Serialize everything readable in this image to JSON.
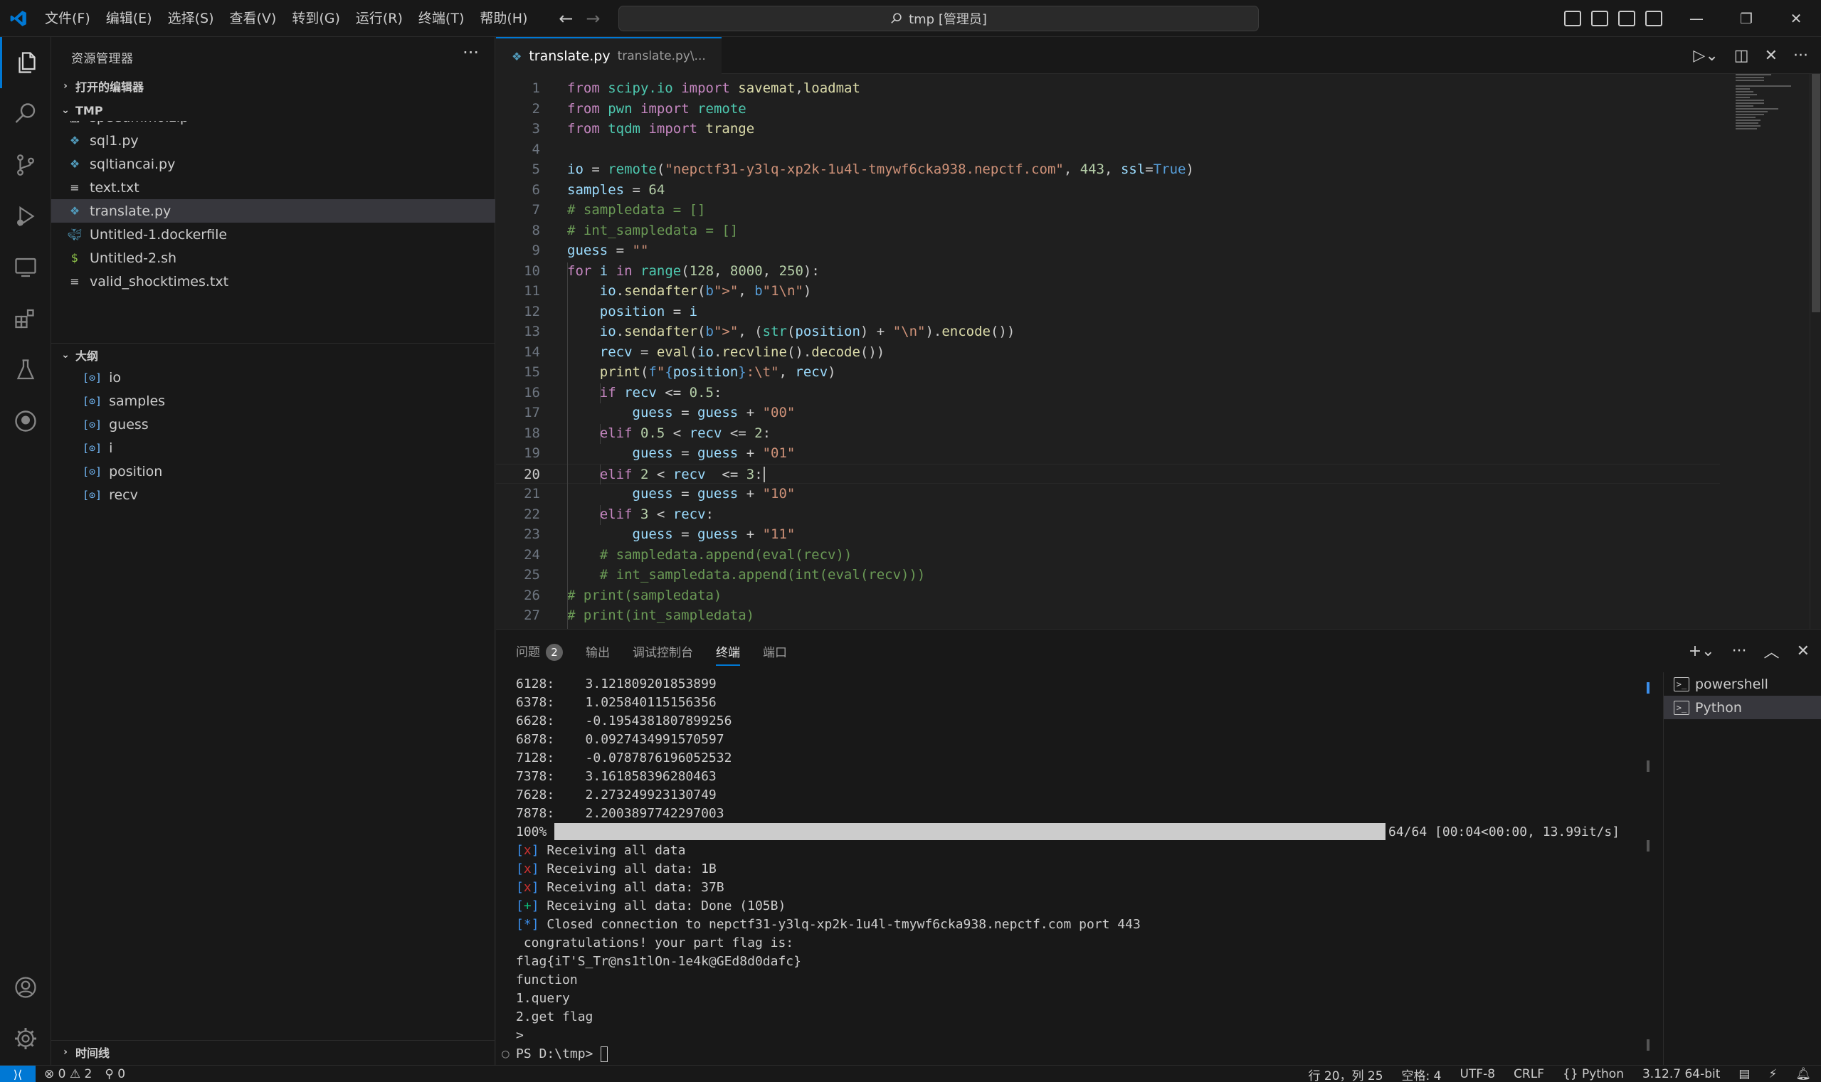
{
  "titlebar": {
    "menus": [
      "文件(F)",
      "编辑(E)",
      "选择(S)",
      "查看(V)",
      "转到(G)",
      "运行(R)",
      "终端(T)",
      "帮助(H)"
    ],
    "search_text": "tmp [管理员]",
    "accent": "#0078d4"
  },
  "sidebar": {
    "title": "资源管理器",
    "open_editors": "打开的编辑器",
    "folder": "TMP",
    "files": [
      {
        "name": "speedmmo.zip",
        "icon": "zip-icon",
        "color": "#cccccc"
      },
      {
        "name": "sql1.py",
        "icon": "python-icon",
        "color": "#519aba"
      },
      {
        "name": "sqltiancai.py",
        "icon": "python-icon",
        "color": "#519aba"
      },
      {
        "name": "text.txt",
        "icon": "text-file-icon",
        "color": "#cccccc"
      },
      {
        "name": "translate.py",
        "icon": "python-icon",
        "color": "#519aba"
      },
      {
        "name": "Untitled-1.dockerfile",
        "icon": "docker-icon",
        "color": "#519aba"
      },
      {
        "name": "Untitled-2.sh",
        "icon": "shell-icon",
        "color": "#8dc149"
      },
      {
        "name": "valid_shocktimes.txt",
        "icon": "text-file-icon",
        "color": "#cccccc"
      }
    ],
    "outline_title": "大纲",
    "outline": [
      "io",
      "samples",
      "guess",
      "i",
      "position",
      "recv"
    ],
    "timeline": "时间线"
  },
  "editor": {
    "tab_name": "translate.py",
    "tab_path": "translate.py\\...",
    "current_line": 20,
    "lines": [
      {
        "n": "1",
        "html": "<span class='kw'>from</span> <span class='mod'>scipy.io</span> <span class='kw'>import</span> <span class='fn'>savemat</span>,<span class='fn'>loadmat</span>"
      },
      {
        "n": "2",
        "html": "<span class='kw'>from</span> <span class='mod'>pwn</span> <span class='kw'>import</span> <span class='mod'>remote</span>"
      },
      {
        "n": "3",
        "html": "<span class='kw'>from</span> <span class='mod'>tqdm</span> <span class='kw'>import</span> <span class='fn'>trange</span>"
      },
      {
        "n": "4",
        "html": ""
      },
      {
        "n": "5",
        "html": "<span class='var'>io</span> = <span class='mod'>remote</span>(<span class='str'>\"nepctf31-y3lq-xp2k-1u4l-tmywf6cka938.nepctf.com\"</span>, <span class='num'>443</span>, <span class='var'>ssl</span>=<span class='bkw'>True</span>)"
      },
      {
        "n": "6",
        "html": "<span class='var'>samples</span> = <span class='num'>64</span>"
      },
      {
        "n": "7",
        "html": "<span class='cm'># sampledata = []</span>"
      },
      {
        "n": "8",
        "html": "<span class='cm'># int_sampledata = []</span>"
      },
      {
        "n": "9",
        "html": "<span class='var'>guess</span> = <span class='str'>\"\"</span>"
      },
      {
        "n": "10",
        "html": "<span class='kw'>for</span> <span class='var'>i</span> <span class='kw'>in</span> <span class='mod'>range</span>(<span class='num'>128</span>, <span class='num'>8000</span>, <span class='num'>250</span>):"
      },
      {
        "n": "11",
        "html": "    <span class='var'>io</span>.<span class='fn'>sendafter</span>(<span class='bkw'>b</span><span class='str'>\"&gt;\"</span>, <span class='bkw'>b</span><span class='str'>\"1\\n\"</span>)"
      },
      {
        "n": "12",
        "html": "    <span class='var'>position</span> = <span class='var'>i</span>"
      },
      {
        "n": "13",
        "html": "    <span class='var'>io</span>.<span class='fn'>sendafter</span>(<span class='bkw'>b</span><span class='str'>\"&gt;\"</span>, (<span class='mod'>str</span>(<span class='var'>position</span>) + <span class='str'>\"\\n\"</span>).<span class='fn'>encode</span>())"
      },
      {
        "n": "14",
        "html": "    <span class='var'>recv</span> = <span class='fn'>eval</span>(<span class='var'>io</span>.<span class='fn'>recvline</span>().<span class='fn'>decode</span>())"
      },
      {
        "n": "15",
        "html": "    <span class='fn'>print</span>(<span class='bkw'>f</span><span class='str'>\"</span><span class='bkw'>{</span><span class='var'>position</span><span class='bkw'>}</span><span class='str'>:\\t\"</span>, <span class='var'>recv</span>)"
      },
      {
        "n": "16",
        "html": "    <span class='kw'>if</span> <span class='var'>recv</span> &lt;= <span class='num'>0.5</span>:"
      },
      {
        "n": "17",
        "html": "        <span class='var'>guess</span> = <span class='var'>guess</span> + <span class='str'>\"00\"</span>"
      },
      {
        "n": "18",
        "html": "    <span class='kw'>elif</span> <span class='num'>0.5</span> &lt; <span class='var'>recv</span> &lt;= <span class='num'>2</span>:"
      },
      {
        "n": "19",
        "html": "        <span class='var'>guess</span> = <span class='var'>guess</span> + <span class='str'>\"01\"</span>"
      },
      {
        "n": "20",
        "html": "    <span class='kw'>elif</span> <span class='num'>2</span> &lt; <span class='var'>recv</span>  &lt;= <span class='num'>3</span>:"
      },
      {
        "n": "21",
        "html": "        <span class='var'>guess</span> = <span class='var'>guess</span> + <span class='str'>\"10\"</span>"
      },
      {
        "n": "22",
        "html": "    <span class='kw'>elif</span> <span class='num'>3</span> &lt; <span class='var'>recv</span>:"
      },
      {
        "n": "23",
        "html": "        <span class='var'>guess</span> = <span class='var'>guess</span> + <span class='str'>\"11\"</span>"
      },
      {
        "n": "24",
        "html": "    <span class='cm'># sampledata.append(eval(recv))</span>"
      },
      {
        "n": "25",
        "html": "    <span class='cm'># int_sampledata.append(int(eval(recv)))</span>"
      },
      {
        "n": "26",
        "html": "<span class='cm'># print(sampledata)</span>"
      },
      {
        "n": "27",
        "html": "<span class='cm'># print(int_sampledata)</span>"
      }
    ]
  },
  "panel": {
    "tabs": [
      "问题",
      "输出",
      "调试控制台",
      "终端",
      "端口"
    ],
    "problems_count": "2",
    "active_tab": "终端",
    "terminals": [
      "powershell",
      "Python"
    ],
    "terminal_lines": [
      {
        "type": "plain",
        "text": "6128:    3.121809201853899"
      },
      {
        "type": "plain",
        "text": "6378:    1.025840115156356"
      },
      {
        "type": "plain",
        "text": "6628:    -0.1954381807899256"
      },
      {
        "type": "plain",
        "text": "6878:    0.0927434991570597"
      },
      {
        "type": "plain",
        "text": "7128:    -0.0787876196052532"
      },
      {
        "type": "plain",
        "text": "7378:    3.161858396280463"
      },
      {
        "type": "plain",
        "text": "7628:    2.273249923130749"
      },
      {
        "type": "plain",
        "text": "7878:    2.2003897742297003"
      },
      {
        "type": "progress",
        "text": "100%",
        "tail": "64/64 [00:04<00:00, 13.99it/s]",
        "fraction": 1.0
      },
      {
        "type": "bracket",
        "mark": "x",
        "text": " Receiving all data"
      },
      {
        "type": "bracket",
        "mark": "x",
        "text": " Receiving all data: 1B"
      },
      {
        "type": "bracket",
        "mark": "x",
        "text": " Receiving all data: 37B"
      },
      {
        "type": "bracket",
        "mark": "+",
        "text": " Receiving all data: Done (105B)"
      },
      {
        "type": "bracket",
        "mark": "*",
        "text": " Closed connection to nepctf31-y3lq-xp2k-1u4l-tmywf6cka938.nepctf.com port 443"
      },
      {
        "type": "plain",
        "text": " congratulations! your part flag is:"
      },
      {
        "type": "plain",
        "text": "flag{iT'S_Tr@ns1tlOn-1e4k@GEd8d0dafc}"
      },
      {
        "type": "plain",
        "text": "function"
      },
      {
        "type": "plain",
        "text": "1.query"
      },
      {
        "type": "plain",
        "text": "2.get flag"
      },
      {
        "type": "plain",
        "text": ">"
      },
      {
        "type": "prompt",
        "text": "PS D:\\tmp> "
      }
    ]
  },
  "statusbar": {
    "errors": "0",
    "warnings": "2",
    "ports": "0",
    "position": "行 20，列 25",
    "spaces": "空格: 4",
    "encoding": "UTF-8",
    "eol": "CRLF",
    "language": "Python",
    "interpreter": "3.12.7 64-bit"
  }
}
